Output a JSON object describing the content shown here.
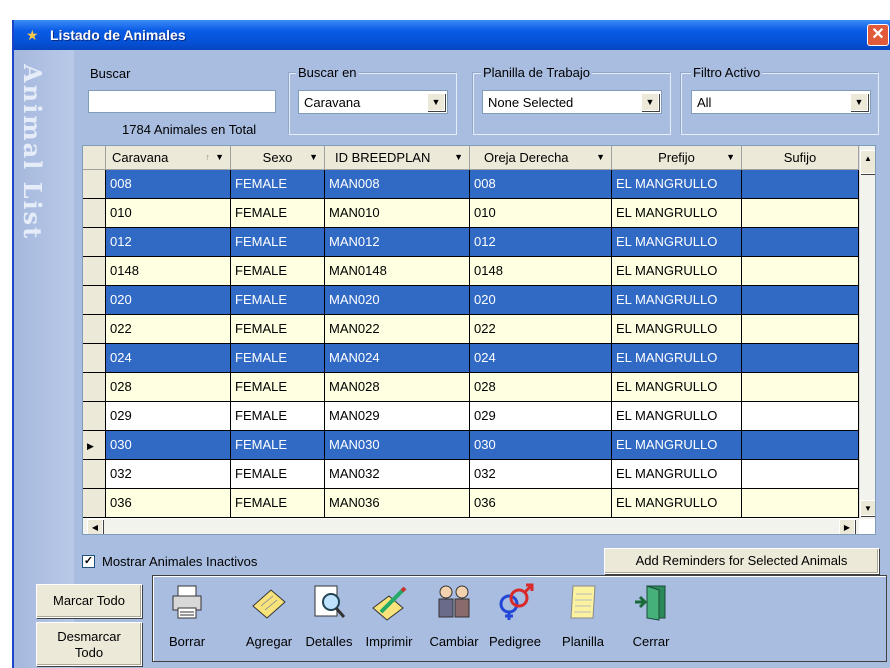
{
  "window": {
    "title": "Listado de Animales",
    "close_glyph": "✕",
    "side_banner": "Animal List"
  },
  "search": {
    "label": "Buscar",
    "value": "",
    "total_text": "1784 Animales en Total"
  },
  "buscar_en": {
    "label": "Buscar en",
    "selected": "Caravana"
  },
  "planilla": {
    "label": "Planilla de Trabajo",
    "selected": "None Selected"
  },
  "filtro": {
    "label": "Filtro Activo",
    "selected": "All"
  },
  "table": {
    "columns": [
      "Caravana",
      "Sexo",
      "ID BREEDPLAN",
      "Oreja Derecha",
      "Prefijo",
      "Sufijo"
    ],
    "rows": [
      {
        "caravana": "008",
        "sexo": "FEMALE",
        "id": "MAN008",
        "oreja": "008",
        "prefijo": "EL MANGRULLO",
        "sufijo": "",
        "style": "selected"
      },
      {
        "caravana": "010",
        "sexo": "FEMALE",
        "id": "MAN010",
        "oreja": "010",
        "prefijo": "EL MANGRULLO",
        "sufijo": "",
        "style": "cream"
      },
      {
        "caravana": "012",
        "sexo": "FEMALE",
        "id": "MAN012",
        "oreja": "012",
        "prefijo": "EL MANGRULLO",
        "sufijo": "",
        "style": "selected"
      },
      {
        "caravana": "0148",
        "sexo": "FEMALE",
        "id": "MAN0148",
        "oreja": "0148",
        "prefijo": "EL MANGRULLO",
        "sufijo": "",
        "style": "cream"
      },
      {
        "caravana": "020",
        "sexo": "FEMALE",
        "id": "MAN020",
        "oreja": "020",
        "prefijo": "EL MANGRULLO",
        "sufijo": "",
        "style": "selected"
      },
      {
        "caravana": "022",
        "sexo": "FEMALE",
        "id": "MAN022",
        "oreja": "022",
        "prefijo": "EL MANGRULLO",
        "sufijo": "",
        "style": "cream"
      },
      {
        "caravana": "024",
        "sexo": "FEMALE",
        "id": "MAN024",
        "oreja": "024",
        "prefijo": "EL MANGRULLO",
        "sufijo": "",
        "style": "selected"
      },
      {
        "caravana": "028",
        "sexo": "FEMALE",
        "id": "MAN028",
        "oreja": "028",
        "prefijo": "EL MANGRULLO",
        "sufijo": "",
        "style": "cream"
      },
      {
        "caravana": "029",
        "sexo": "FEMALE",
        "id": "MAN029",
        "oreja": "029",
        "prefijo": "EL MANGRULLO",
        "sufijo": "",
        "style": "white"
      },
      {
        "caravana": "030",
        "sexo": "FEMALE",
        "id": "MAN030",
        "oreja": "030",
        "prefijo": "EL MANGRULLO",
        "sufijo": "",
        "style": "selected",
        "current": true
      },
      {
        "caravana": "032",
        "sexo": "FEMALE",
        "id": "MAN032",
        "oreja": "032",
        "prefijo": "EL MANGRULLO",
        "sufijo": "",
        "style": "white"
      },
      {
        "caravana": "036",
        "sexo": "FEMALE",
        "id": "MAN036",
        "oreja": "036",
        "prefijo": "EL MANGRULLO",
        "sufijo": "",
        "style": "cream"
      }
    ]
  },
  "mostrar_inactivos": {
    "label": "Mostrar Animales Inactivos",
    "checked": true
  },
  "reminders_button": "Add Reminders for Selected Animals",
  "marcar_todo": "Marcar Todo",
  "desmarcar_todo": "Desmarcar Todo",
  "toolbar": [
    {
      "label": "Borrar",
      "icon": "printer-icon"
    },
    {
      "label": "Agregar",
      "icon": "notepad-add-icon"
    },
    {
      "label": "Detalles",
      "icon": "magnifier-icon"
    },
    {
      "label": "Imprimir",
      "icon": "pencil-paper-icon"
    },
    {
      "label": "Cambiar",
      "icon": "people-exchange-icon"
    },
    {
      "label": "Pedigree",
      "icon": "gender-symbols-icon"
    },
    {
      "label": "Planilla",
      "icon": "notepad-icon"
    },
    {
      "label": "Cerrar",
      "icon": "exit-door-icon"
    }
  ],
  "colors": {
    "selection": "#316ac5",
    "cream_row": "#ffffe1",
    "window_bg": "#a9bde0",
    "titlebar": "#0553d8"
  }
}
